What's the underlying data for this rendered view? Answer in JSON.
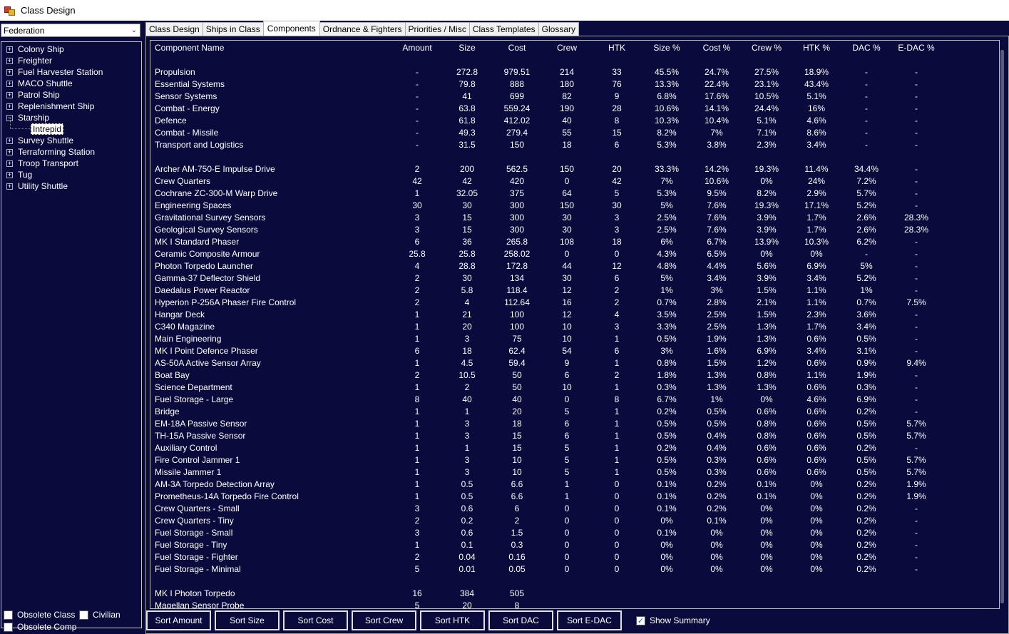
{
  "window": {
    "title": "Class Design"
  },
  "left": {
    "race_select": "Federation",
    "tree": [
      {
        "label": "Colony Ship",
        "expanded": false
      },
      {
        "label": "Freighter",
        "expanded": false
      },
      {
        "label": "Fuel Harvester Station",
        "expanded": false
      },
      {
        "label": "MACO Shuttle",
        "expanded": false
      },
      {
        "label": "Patrol Ship",
        "expanded": false
      },
      {
        "label": "Replenishment Ship",
        "expanded": false
      },
      {
        "label": "Starship",
        "expanded": true,
        "children": [
          "Intrepid"
        ]
      },
      {
        "label": "Survey Shuttle",
        "expanded": false
      },
      {
        "label": "Terraforming Station",
        "expanded": false
      },
      {
        "label": "Troop Transport",
        "expanded": false
      },
      {
        "label": "Tug",
        "expanded": false
      },
      {
        "label": "Utility Shuttle",
        "expanded": false
      }
    ],
    "obsolete_class": "Obsolete Class",
    "civilian": "Civilian",
    "obsolete_comp": "Obsolete Comp"
  },
  "tabs": [
    "Class Design",
    "Ships in Class",
    "Components",
    "Ordnance & Fighters",
    "Priorities / Misc",
    "Class Templates",
    "Glossary"
  ],
  "active_tab": "Components",
  "grid": {
    "headers": [
      "Component Name",
      "Amount",
      "Size",
      "Cost",
      "Crew",
      "HTK",
      "Size %",
      "Cost %",
      "Crew %",
      "HTK %",
      "DAC %",
      "E-DAC %"
    ],
    "summary": [
      [
        "Propulsion",
        "-",
        "272.8",
        "979.51",
        "214",
        "33",
        "45.5%",
        "24.7%",
        "27.5%",
        "18.9%",
        "-",
        "-"
      ],
      [
        "Essential Systems",
        "-",
        "79.8",
        "888",
        "180",
        "76",
        "13.3%",
        "22.4%",
        "23.1%",
        "43.4%",
        "-",
        "-"
      ],
      [
        "Sensor Systems",
        "-",
        "41",
        "699",
        "82",
        "9",
        "6.8%",
        "17.6%",
        "10.5%",
        "5.1%",
        "-",
        "-"
      ],
      [
        "Combat - Energy",
        "-",
        "63.8",
        "559.24",
        "190",
        "28",
        "10.6%",
        "14.1%",
        "24.4%",
        "16%",
        "-",
        "-"
      ],
      [
        "Defence",
        "-",
        "61.8",
        "412.02",
        "40",
        "8",
        "10.3%",
        "10.4%",
        "5.1%",
        "4.6%",
        "-",
        "-"
      ],
      [
        "Combat - Missile",
        "-",
        "49.3",
        "279.4",
        "55",
        "15",
        "8.2%",
        "7%",
        "7.1%",
        "8.6%",
        "-",
        "-"
      ],
      [
        "Transport and Logistics",
        "-",
        "31.5",
        "150",
        "18",
        "6",
        "5.3%",
        "3.8%",
        "2.3%",
        "3.4%",
        "-",
        "-"
      ]
    ],
    "components": [
      [
        "Archer AM-750-E Impulse Drive",
        "2",
        "200",
        "562.5",
        "150",
        "20",
        "33.3%",
        "14.2%",
        "19.3%",
        "11.4%",
        "34.4%",
        "-"
      ],
      [
        "Crew Quarters",
        "42",
        "42",
        "420",
        "0",
        "42",
        "7%",
        "10.6%",
        "0%",
        "24%",
        "7.2%",
        "-"
      ],
      [
        "Cochrane ZC-300-M Warp Drive",
        "1",
        "32.05",
        "375",
        "64",
        "5",
        "5.3%",
        "9.5%",
        "8.2%",
        "2.9%",
        "5.7%",
        "-"
      ],
      [
        "Engineering Spaces",
        "30",
        "30",
        "300",
        "150",
        "30",
        "5%",
        "7.6%",
        "19.3%",
        "17.1%",
        "5.2%",
        "-"
      ],
      [
        "Gravitational Survey Sensors",
        "3",
        "15",
        "300",
        "30",
        "3",
        "2.5%",
        "7.6%",
        "3.9%",
        "1.7%",
        "2.6%",
        "28.3%"
      ],
      [
        "Geological Survey Sensors",
        "3",
        "15",
        "300",
        "30",
        "3",
        "2.5%",
        "7.6%",
        "3.9%",
        "1.7%",
        "2.6%",
        "28.3%"
      ],
      [
        "MK I Standard Phaser",
        "6",
        "36",
        "265.8",
        "108",
        "18",
        "6%",
        "6.7%",
        "13.9%",
        "10.3%",
        "6.2%",
        "-"
      ],
      [
        "Ceramic Composite Armour",
        "25.8",
        "25.8",
        "258.02",
        "0",
        "0",
        "4.3%",
        "6.5%",
        "0%",
        "0%",
        "-",
        "-"
      ],
      [
        "Photon Torpedo Launcher",
        "4",
        "28.8",
        "172.8",
        "44",
        "12",
        "4.8%",
        "4.4%",
        "5.6%",
        "6.9%",
        "5%",
        "-"
      ],
      [
        "Gamma-37 Deflector Shield",
        "2",
        "30",
        "134",
        "30",
        "6",
        "5%",
        "3.4%",
        "3.9%",
        "3.4%",
        "5.2%",
        "-"
      ],
      [
        "Daedalus Power Reactor",
        "2",
        "5.8",
        "118.4",
        "12",
        "2",
        "1%",
        "3%",
        "1.5%",
        "1.1%",
        "1%",
        "-"
      ],
      [
        "Hyperion P-256A Phaser Fire Control",
        "2",
        "4",
        "112.64",
        "16",
        "2",
        "0.7%",
        "2.8%",
        "2.1%",
        "1.1%",
        "0.7%",
        "7.5%"
      ],
      [
        "Hangar Deck",
        "1",
        "21",
        "100",
        "12",
        "4",
        "3.5%",
        "2.5%",
        "1.5%",
        "2.3%",
        "3.6%",
        "-"
      ],
      [
        "C340 Magazine",
        "1",
        "20",
        "100",
        "10",
        "3",
        "3.3%",
        "2.5%",
        "1.3%",
        "1.7%",
        "3.4%",
        "-"
      ],
      [
        "Main Engineering",
        "1",
        "3",
        "75",
        "10",
        "1",
        "0.5%",
        "1.9%",
        "1.3%",
        "0.6%",
        "0.5%",
        "-"
      ],
      [
        "MK I Point Defence Phaser",
        "6",
        "18",
        "62.4",
        "54",
        "6",
        "3%",
        "1.6%",
        "6.9%",
        "3.4%",
        "3.1%",
        "-"
      ],
      [
        "AS-50A Active Sensor Array",
        "1",
        "4.5",
        "59.4",
        "9",
        "1",
        "0.8%",
        "1.5%",
        "1.2%",
        "0.6%",
        "0.9%",
        "9.4%"
      ],
      [
        "Boat Bay",
        "2",
        "10.5",
        "50",
        "6",
        "2",
        "1.8%",
        "1.3%",
        "0.8%",
        "1.1%",
        "1.9%",
        "-"
      ],
      [
        "Science Department",
        "1",
        "2",
        "50",
        "10",
        "1",
        "0.3%",
        "1.3%",
        "1.3%",
        "0.6%",
        "0.3%",
        "-"
      ],
      [
        "Fuel Storage - Large",
        "8",
        "40",
        "40",
        "0",
        "8",
        "6.7%",
        "1%",
        "0%",
        "4.6%",
        "6.9%",
        "-"
      ],
      [
        "Bridge",
        "1",
        "1",
        "20",
        "5",
        "1",
        "0.2%",
        "0.5%",
        "0.6%",
        "0.6%",
        "0.2%",
        "-"
      ],
      [
        "EM-18A Passive Sensor",
        "1",
        "3",
        "18",
        "6",
        "1",
        "0.5%",
        "0.5%",
        "0.8%",
        "0.6%",
        "0.5%",
        "5.7%"
      ],
      [
        "TH-15A Passive Sensor",
        "1",
        "3",
        "15",
        "6",
        "1",
        "0.5%",
        "0.4%",
        "0.8%",
        "0.6%",
        "0.5%",
        "5.7%"
      ],
      [
        "Auxiliary Control",
        "1",
        "1",
        "15",
        "5",
        "1",
        "0.2%",
        "0.4%",
        "0.6%",
        "0.6%",
        "0.2%",
        "-"
      ],
      [
        "Fire Control Jammer 1",
        "1",
        "3",
        "10",
        "5",
        "1",
        "0.5%",
        "0.3%",
        "0.6%",
        "0.6%",
        "0.5%",
        "5.7%"
      ],
      [
        "Missile Jammer 1",
        "1",
        "3",
        "10",
        "5",
        "1",
        "0.5%",
        "0.3%",
        "0.6%",
        "0.6%",
        "0.5%",
        "5.7%"
      ],
      [
        "AM-3A Torpedo Detection Array",
        "1",
        "0.5",
        "6.6",
        "1",
        "0",
        "0.1%",
        "0.2%",
        "0.1%",
        "0%",
        "0.2%",
        "1.9%"
      ],
      [
        "Prometheus-14A Torpedo Fire Control",
        "1",
        "0.5",
        "6.6",
        "1",
        "0",
        "0.1%",
        "0.2%",
        "0.1%",
        "0%",
        "0.2%",
        "1.9%"
      ],
      [
        "Crew Quarters - Small",
        "3",
        "0.6",
        "6",
        "0",
        "0",
        "0.1%",
        "0.2%",
        "0%",
        "0%",
        "0.2%",
        "-"
      ],
      [
        "Crew Quarters - Tiny",
        "2",
        "0.2",
        "2",
        "0",
        "0",
        "0%",
        "0.1%",
        "0%",
        "0%",
        "0.2%",
        "-"
      ],
      [
        "Fuel Storage - Small",
        "3",
        "0.6",
        "1.5",
        "0",
        "0",
        "0.1%",
        "0%",
        "0%",
        "0%",
        "0.2%",
        "-"
      ],
      [
        "Fuel Storage - Tiny",
        "1",
        "0.1",
        "0.3",
        "0",
        "0",
        "0%",
        "0%",
        "0%",
        "0%",
        "0.2%",
        "-"
      ],
      [
        "Fuel Storage - Fighter",
        "2",
        "0.04",
        "0.16",
        "0",
        "0",
        "0%",
        "0%",
        "0%",
        "0%",
        "0.2%",
        "-"
      ],
      [
        "Fuel Storage - Minimal",
        "5",
        "0.01",
        "0.05",
        "0",
        "0",
        "0%",
        "0%",
        "0%",
        "0%",
        "0.2%",
        "-"
      ]
    ],
    "ordnance": [
      [
        "MK I Photon Torpedo",
        "16",
        "384",
        "505"
      ],
      [
        "Magellan Sensor Probe",
        "5",
        "20",
        "8"
      ]
    ]
  },
  "bottom": {
    "sort_buttons": [
      "Sort Amount",
      "Sort Size",
      "Sort Cost",
      "Sort Crew",
      "Sort HTK",
      "Sort DAC",
      "Sort E-DAC"
    ],
    "show_summary": "Show Summary",
    "show_summary_checked": true
  }
}
